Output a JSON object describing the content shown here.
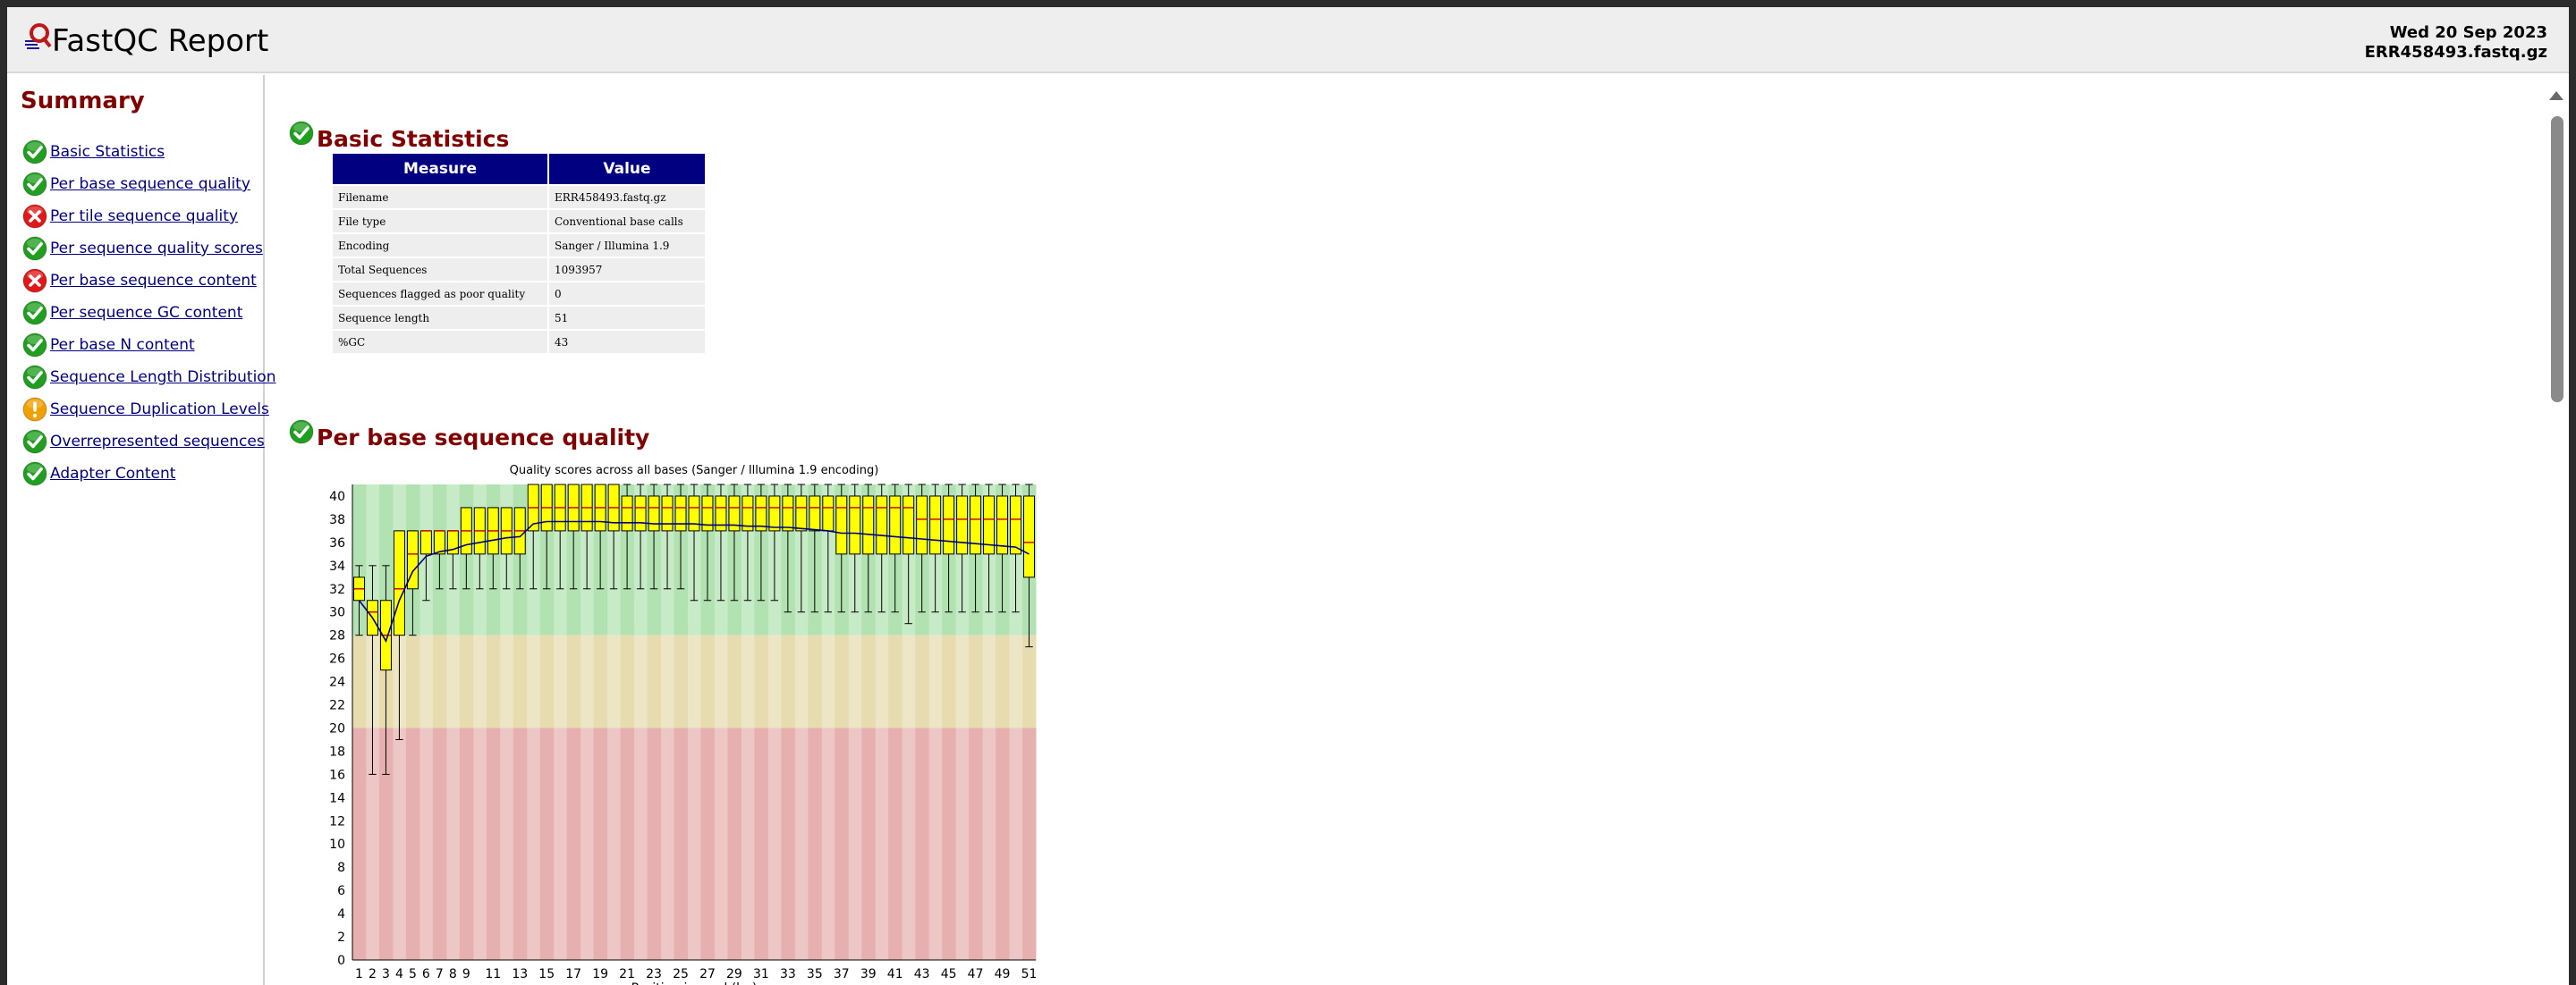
{
  "app": {
    "title": "FastQC Report",
    "date": "Wed 20 Sep 2023",
    "filename": "ERR458493.fastq.gz"
  },
  "summary": {
    "title": "Summary",
    "modules": [
      {
        "label": "Basic Statistics",
        "status": "pass"
      },
      {
        "label": "Per base sequence quality",
        "status": "pass"
      },
      {
        "label": "Per tile sequence quality",
        "status": "fail"
      },
      {
        "label": "Per sequence quality scores",
        "status": "pass"
      },
      {
        "label": "Per base sequence content",
        "status": "fail"
      },
      {
        "label": "Per sequence GC content",
        "status": "pass"
      },
      {
        "label": "Per base N content",
        "status": "pass"
      },
      {
        "label": "Sequence Length Distribution",
        "status": "pass"
      },
      {
        "label": "Sequence Duplication Levels",
        "status": "warn"
      },
      {
        "label": "Overrepresented sequences",
        "status": "pass"
      },
      {
        "label": "Adapter Content",
        "status": "pass"
      }
    ]
  },
  "basic_stats": {
    "heading": "Basic Statistics",
    "status": "pass",
    "col_measure": "Measure",
    "col_value": "Value",
    "rows": [
      {
        "measure": "Filename",
        "value": "ERR458493.fastq.gz"
      },
      {
        "measure": "File type",
        "value": "Conventional base calls"
      },
      {
        "measure": "Encoding",
        "value": "Sanger / Illumina 1.9"
      },
      {
        "measure": "Total Sequences",
        "value": "1093957"
      },
      {
        "measure": "Sequences flagged as poor quality",
        "value": "0"
      },
      {
        "measure": "Sequence length",
        "value": "51"
      },
      {
        "measure": "%GC",
        "value": "43"
      }
    ]
  },
  "quality_section": {
    "heading": "Per base sequence quality",
    "status": "pass"
  },
  "colors": {
    "pass": "#1f9e1f",
    "fail": "#e01818",
    "warn": "#f0a000",
    "zone_good": "#b2e2b2",
    "zone_warn": "#e6dcb0",
    "zone_bad": "#e6b0b0",
    "box_fill": "#ffff00",
    "mean_line": "#000080"
  },
  "icons": {
    "pass": "check-circle-icon",
    "fail": "cross-circle-icon",
    "warn": "exclamation-circle-icon",
    "logo": "fastqc-logo-icon"
  },
  "chart_data": {
    "type": "box",
    "title": "Quality scores across all bases (Sanger / Illumina 1.9 encoding)",
    "xlabel": "Position in read (bp)",
    "ylabel": "",
    "ylim": [
      0,
      41
    ],
    "y_ticks": [
      0,
      2,
      4,
      6,
      8,
      10,
      12,
      14,
      16,
      18,
      20,
      22,
      24,
      26,
      28,
      30,
      32,
      34,
      36,
      38,
      40
    ],
    "x_tick_labels": [
      "1",
      "2",
      "3",
      "4",
      "5",
      "6",
      "7",
      "8",
      "9",
      "11",
      "13",
      "15",
      "17",
      "19",
      "21",
      "23",
      "25",
      "27",
      "29",
      "31",
      "33",
      "35",
      "37",
      "39",
      "41",
      "43",
      "45",
      "47",
      "49",
      "51"
    ],
    "zones": [
      {
        "name": "good",
        "from": 28,
        "to": 41
      },
      {
        "name": "acceptable",
        "from": 20,
        "to": 28
      },
      {
        "name": "poor",
        "from": 0,
        "to": 20
      }
    ],
    "grid": false,
    "positions": [
      {
        "x": 1,
        "min": 28,
        "q1": 31,
        "median": 32,
        "q3": 33,
        "max": 34,
        "mean": 31.0
      },
      {
        "x": 2,
        "min": 16,
        "q1": 28,
        "median": 30,
        "q3": 31,
        "max": 34,
        "mean": 29.5
      },
      {
        "x": 3,
        "min": 16,
        "q1": 25,
        "median": 28,
        "q3": 31,
        "max": 34,
        "mean": 27.5
      },
      {
        "x": 4,
        "min": 19,
        "q1": 28,
        "median": 32,
        "q3": 37,
        "max": 37,
        "mean": 31.0
      },
      {
        "x": 5,
        "min": 28,
        "q1": 32,
        "median": 35,
        "q3": 37,
        "max": 37,
        "mean": 33.5
      },
      {
        "x": 6,
        "min": 31,
        "q1": 35,
        "median": 37,
        "q3": 37,
        "max": 37,
        "mean": 34.8
      },
      {
        "x": 7,
        "min": 32,
        "q1": 35,
        "median": 37,
        "q3": 37,
        "max": 37,
        "mean": 35.2
      },
      {
        "x": 8,
        "min": 32,
        "q1": 35,
        "median": 37,
        "q3": 37,
        "max": 37,
        "mean": 35.4
      },
      {
        "x": 9,
        "min": 32,
        "q1": 35,
        "median": 37,
        "q3": 39,
        "max": 39,
        "mean": 35.8
      },
      {
        "x": 10,
        "min": 32,
        "q1": 35,
        "median": 37,
        "q3": 39,
        "max": 39,
        "mean": 36.0
      },
      {
        "x": 11,
        "min": 32,
        "q1": 35,
        "median": 37,
        "q3": 39,
        "max": 39,
        "mean": 36.2
      },
      {
        "x": 12,
        "min": 32,
        "q1": 35,
        "median": 37,
        "q3": 39,
        "max": 39,
        "mean": 36.4
      },
      {
        "x": 13,
        "min": 32,
        "q1": 35,
        "median": 37,
        "q3": 39,
        "max": 39,
        "mean": 36.5
      },
      {
        "x": 14,
        "min": 32,
        "q1": 37,
        "median": 39,
        "q3": 41,
        "max": 41,
        "mean": 37.6
      },
      {
        "x": 15,
        "min": 32,
        "q1": 37,
        "median": 39,
        "q3": 41,
        "max": 41,
        "mean": 37.8
      },
      {
        "x": 16,
        "min": 32,
        "q1": 37,
        "median": 39,
        "q3": 41,
        "max": 41,
        "mean": 37.8
      },
      {
        "x": 17,
        "min": 32,
        "q1": 37,
        "median": 39,
        "q3": 41,
        "max": 41,
        "mean": 37.8
      },
      {
        "x": 18,
        "min": 32,
        "q1": 37,
        "median": 39,
        "q3": 41,
        "max": 41,
        "mean": 37.8
      },
      {
        "x": 19,
        "min": 32,
        "q1": 37,
        "median": 39,
        "q3": 41,
        "max": 41,
        "mean": 37.8
      },
      {
        "x": 20,
        "min": 32,
        "q1": 37,
        "median": 39,
        "q3": 41,
        "max": 41,
        "mean": 37.7
      },
      {
        "x": 21,
        "min": 32,
        "q1": 37,
        "median": 39,
        "q3": 40,
        "max": 41,
        "mean": 37.7
      },
      {
        "x": 22,
        "min": 32,
        "q1": 37,
        "median": 39,
        "q3": 40,
        "max": 41,
        "mean": 37.7
      },
      {
        "x": 23,
        "min": 32,
        "q1": 37,
        "median": 39,
        "q3": 40,
        "max": 41,
        "mean": 37.6
      },
      {
        "x": 24,
        "min": 32,
        "q1": 37,
        "median": 39,
        "q3": 40,
        "max": 41,
        "mean": 37.6
      },
      {
        "x": 25,
        "min": 32,
        "q1": 37,
        "median": 39,
        "q3": 40,
        "max": 41,
        "mean": 37.6
      },
      {
        "x": 26,
        "min": 31,
        "q1": 37,
        "median": 39,
        "q3": 40,
        "max": 41,
        "mean": 37.6
      },
      {
        "x": 27,
        "min": 31,
        "q1": 37,
        "median": 39,
        "q3": 40,
        "max": 41,
        "mean": 37.5
      },
      {
        "x": 28,
        "min": 31,
        "q1": 37,
        "median": 39,
        "q3": 40,
        "max": 41,
        "mean": 37.5
      },
      {
        "x": 29,
        "min": 31,
        "q1": 37,
        "median": 39,
        "q3": 40,
        "max": 41,
        "mean": 37.5
      },
      {
        "x": 30,
        "min": 31,
        "q1": 37,
        "median": 39,
        "q3": 40,
        "max": 41,
        "mean": 37.4
      },
      {
        "x": 31,
        "min": 31,
        "q1": 37,
        "median": 39,
        "q3": 40,
        "max": 41,
        "mean": 37.4
      },
      {
        "x": 32,
        "min": 31,
        "q1": 37,
        "median": 39,
        "q3": 40,
        "max": 41,
        "mean": 37.3
      },
      {
        "x": 33,
        "min": 30,
        "q1": 37,
        "median": 39,
        "q3": 40,
        "max": 41,
        "mean": 37.3
      },
      {
        "x": 34,
        "min": 30,
        "q1": 37,
        "median": 39,
        "q3": 40,
        "max": 41,
        "mean": 37.2
      },
      {
        "x": 35,
        "min": 30,
        "q1": 37,
        "median": 39,
        "q3": 40,
        "max": 41,
        "mean": 37.1
      },
      {
        "x": 36,
        "min": 30,
        "q1": 37,
        "median": 39,
        "q3": 40,
        "max": 41,
        "mean": 37.0
      },
      {
        "x": 37,
        "min": 30,
        "q1": 35,
        "median": 39,
        "q3": 40,
        "max": 41,
        "mean": 36.8
      },
      {
        "x": 38,
        "min": 30,
        "q1": 35,
        "median": 39,
        "q3": 40,
        "max": 41,
        "mean": 36.8
      },
      {
        "x": 39,
        "min": 30,
        "q1": 35,
        "median": 39,
        "q3": 40,
        "max": 41,
        "mean": 36.7
      },
      {
        "x": 40,
        "min": 30,
        "q1": 35,
        "median": 39,
        "q3": 40,
        "max": 41,
        "mean": 36.6
      },
      {
        "x": 41,
        "min": 30,
        "q1": 35,
        "median": 39,
        "q3": 40,
        "max": 41,
        "mean": 36.5
      },
      {
        "x": 42,
        "min": 29,
        "q1": 35,
        "median": 39,
        "q3": 40,
        "max": 41,
        "mean": 36.4
      },
      {
        "x": 43,
        "min": 30,
        "q1": 35,
        "median": 38,
        "q3": 40,
        "max": 41,
        "mean": 36.3
      },
      {
        "x": 44,
        "min": 30,
        "q1": 35,
        "median": 38,
        "q3": 40,
        "max": 41,
        "mean": 36.2
      },
      {
        "x": 45,
        "min": 30,
        "q1": 35,
        "median": 38,
        "q3": 40,
        "max": 41,
        "mean": 36.1
      },
      {
        "x": 46,
        "min": 30,
        "q1": 35,
        "median": 38,
        "q3": 40,
        "max": 41,
        "mean": 36.0
      },
      {
        "x": 47,
        "min": 30,
        "q1": 35,
        "median": 38,
        "q3": 40,
        "max": 41,
        "mean": 35.9
      },
      {
        "x": 48,
        "min": 30,
        "q1": 35,
        "median": 38,
        "q3": 40,
        "max": 41,
        "mean": 35.8
      },
      {
        "x": 49,
        "min": 30,
        "q1": 35,
        "median": 38,
        "q3": 40,
        "max": 41,
        "mean": 35.7
      },
      {
        "x": 50,
        "min": 30,
        "q1": 35,
        "median": 38,
        "q3": 40,
        "max": 41,
        "mean": 35.6
      },
      {
        "x": 51,
        "min": 27,
        "q1": 33,
        "median": 36,
        "q3": 40,
        "max": 41,
        "mean": 35.0
      }
    ]
  }
}
